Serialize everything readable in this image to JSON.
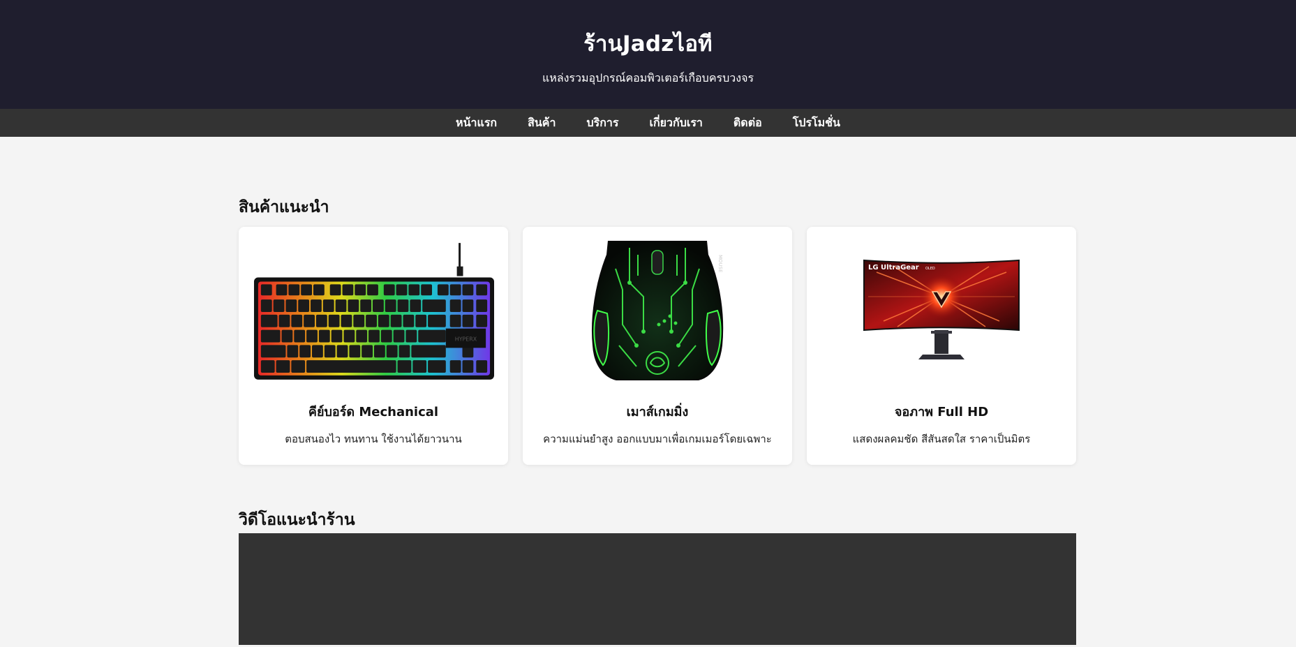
{
  "header": {
    "title": "ร้านJadzไอที",
    "subtitle": "แหล่งรวมอุปกรณ์คอมพิวเตอร์เกือบครบวงจร"
  },
  "nav": {
    "items": [
      {
        "label": "หน้าแรก"
      },
      {
        "label": "สินค้า"
      },
      {
        "label": "บริการ"
      },
      {
        "label": "เกี่ยวกับเรา"
      },
      {
        "label": "ติดต่อ"
      },
      {
        "label": "โปรโมชั่น"
      }
    ]
  },
  "featured": {
    "title": "สินค้าแนะนำ",
    "products": [
      {
        "name": "คีย์บอร์ด Mechanical",
        "desc": "ตอบสนองไว ทนทาน ใช้งานได้ยาวนาน",
        "image_icon": "rgb-mechanical-keyboard-image",
        "keyboard_brand": "HYPERX"
      },
      {
        "name": "เมาส์เกมมิ่ง",
        "desc": "ความแม่นยำสูง ออกแบบมาเพื่อเกมเมอร์โดยเฉพาะ",
        "image_icon": "green-gaming-mouse-image",
        "mouse_label": "MOUSE"
      },
      {
        "name": "จอภาพ Full HD",
        "desc": "แสดงผลคมชัด สีสันสดใส ราคาเป็นมิตร",
        "image_icon": "ultragear-monitor-image",
        "monitor_brand": "LG UltraGear",
        "monitor_sub": "OLED"
      }
    ]
  },
  "video": {
    "title": "วิดีโอแนะนำร้าน"
  },
  "colors": {
    "header_bg": "#1f1e2e",
    "nav_bg": "#333333",
    "page_bg": "#f4f4f4",
    "video_bg": "#333333"
  }
}
